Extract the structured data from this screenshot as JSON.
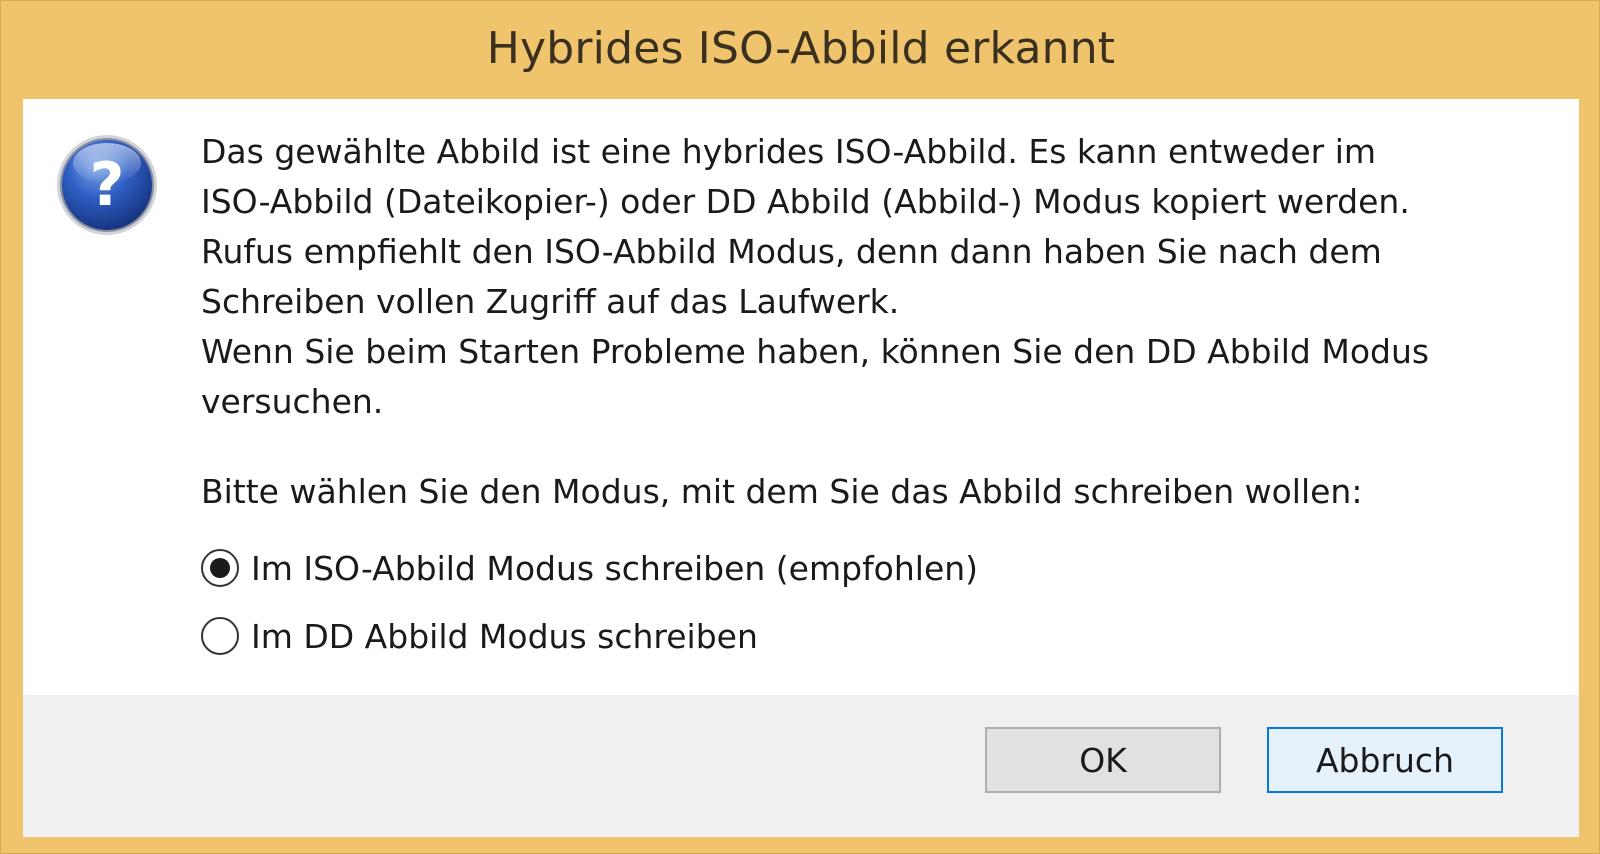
{
  "window": {
    "title": "Hybrides ISO-Abbild erkannt",
    "accent_color": "#f0c46c"
  },
  "message": {
    "icon": "question-icon",
    "lines": [
      "Das gewählte Abbild ist eine hybrides ISO-Abbild. Es kann entweder im",
      "ISO-Abbild (Dateikopier-) oder DD Abbild (Abbild-) Modus kopiert werden.",
      "Rufus empfiehlt den ISO-Abbild Modus, denn dann haben Sie nach dem",
      "Schreiben vollen Zugriff auf das Laufwerk.",
      "Wenn Sie beim Starten Probleme haben, können Sie den DD Abbild Modus",
      "versuchen."
    ],
    "prompt": "Bitte wählen Sie den Modus, mit dem Sie das Abbild schreiben wollen:"
  },
  "options": [
    {
      "label": "Im ISO-Abbild Modus schreiben (empfohlen)",
      "selected": true
    },
    {
      "label": "Im DD Abbild Modus schreiben",
      "selected": false
    }
  ],
  "buttons": {
    "ok_label": "OK",
    "cancel_label": "Abbruch"
  }
}
